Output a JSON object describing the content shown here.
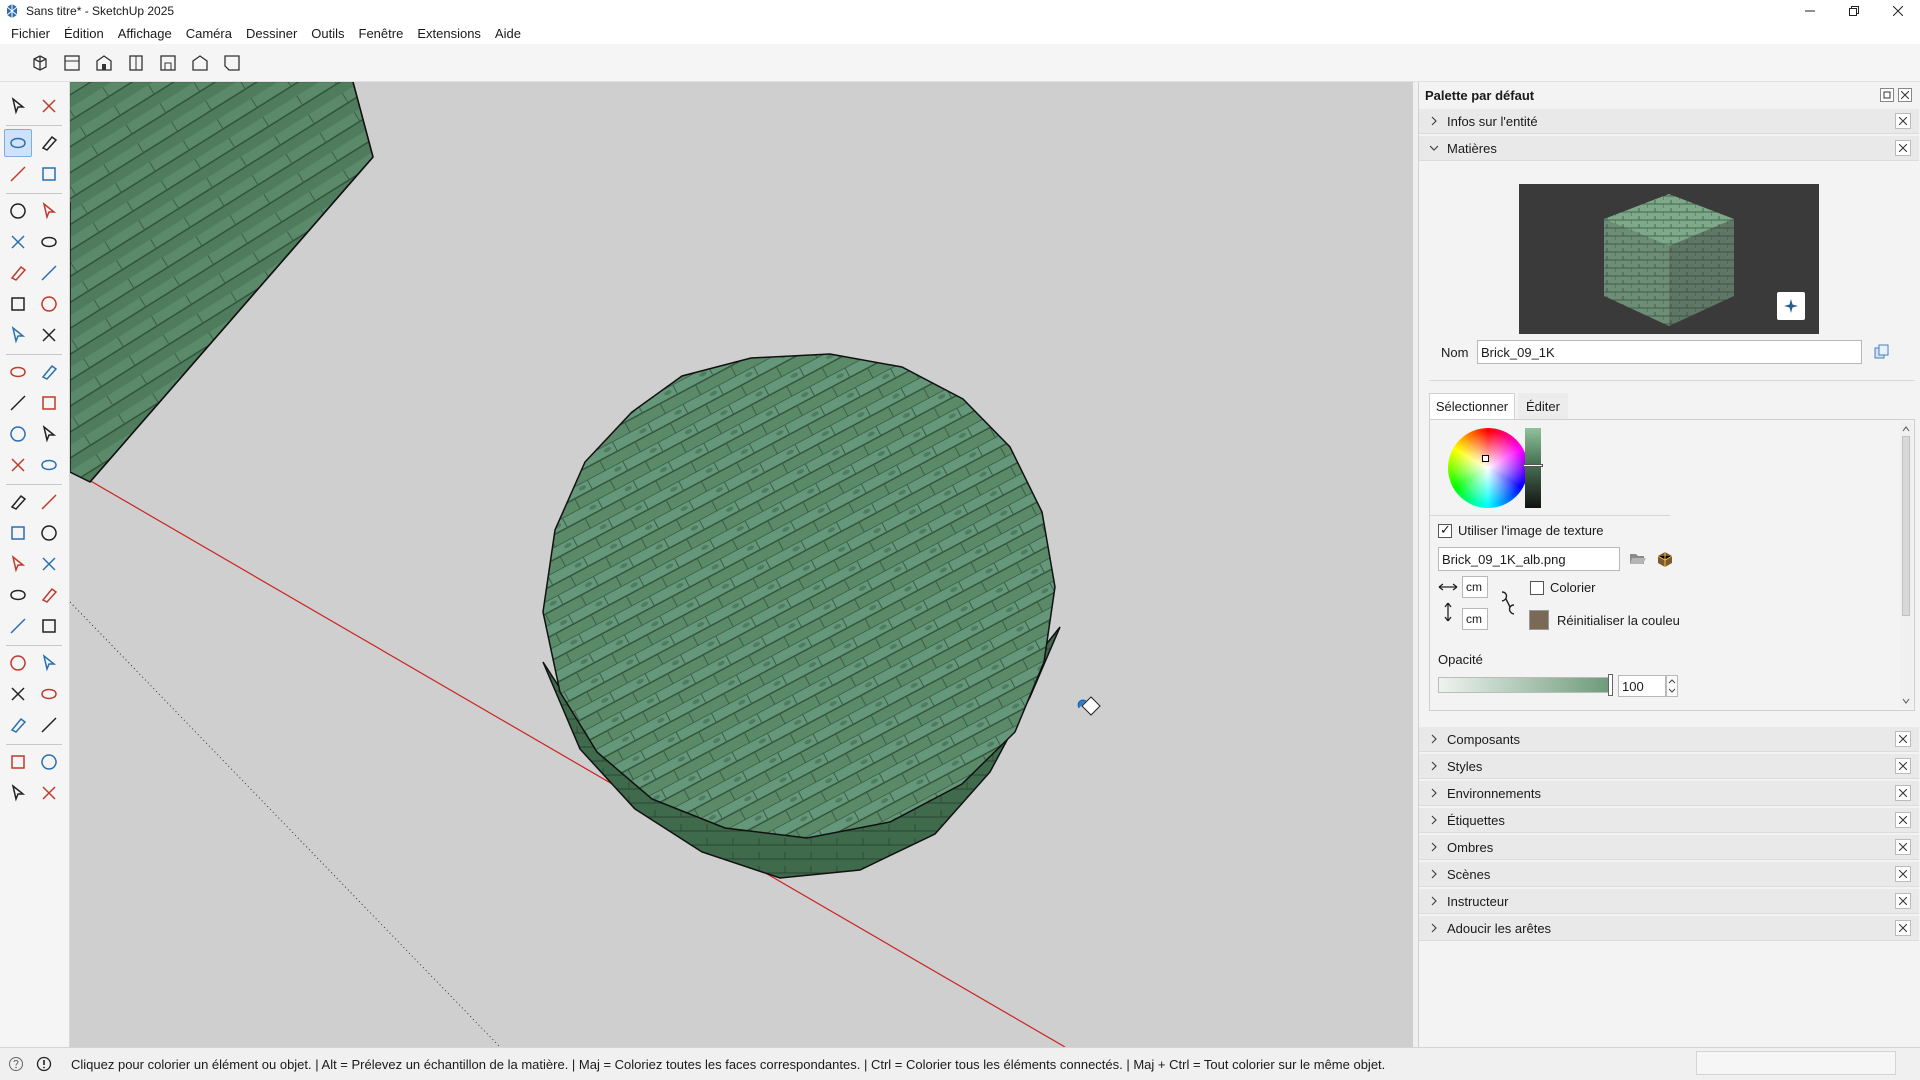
{
  "window": {
    "title": "Sans titre* - SketchUp 2025",
    "controls": [
      "minimize",
      "restore",
      "close"
    ]
  },
  "menu": [
    "Fichier",
    "Édition",
    "Affichage",
    "Caméra",
    "Dessiner",
    "Outils",
    "Fenêtre",
    "Extensions",
    "Aide"
  ],
  "top_toolbar": {
    "icons": [
      "iso-view-icon",
      "top-view-icon",
      "front-view-icon",
      "right-view-icon",
      "back-view-icon",
      "left-view-icon",
      "bottom-view-icon"
    ]
  },
  "left_toolbar": {
    "active_tool": "paint-bucket-icon",
    "tools": [
      "select",
      "lasso",
      "paint-bucket",
      "eraser",
      "tag",
      "tape-eraser",
      "line",
      "freehand",
      "rectangle",
      "rotated-rect",
      "circle",
      "polygon",
      "arc",
      "pie",
      "3pt-arc",
      "2pt-arc",
      "move",
      "push-pull",
      "rotate",
      "follow-me",
      "scale",
      "offset",
      "explode",
      "pyramid",
      "tape-measure",
      "dimension",
      "protractor",
      "text",
      "axes",
      "3d-text",
      "section-plane",
      "pan-hand",
      "zoom",
      "zoom-window",
      "zoom-extents",
      "previous",
      "position-camera",
      "walk",
      "look-around",
      "sound",
      "warehouse",
      "extension-warehouse",
      "layers",
      "components"
    ]
  },
  "panel": {
    "title": "Palette par défaut",
    "trays_top": [
      {
        "label": "Infos sur l'entité",
        "expanded": false
      },
      {
        "label": "Matières",
        "expanded": true
      }
    ],
    "material": {
      "name_label": "Nom",
      "name_value": "Brick_09_1K",
      "tabs": [
        "Sélectionner",
        "Éditer"
      ],
      "active_tab": "Éditer",
      "use_texture_label": "Utiliser l'image de texture",
      "use_texture_checked": true,
      "texture_file": "Brick_09_1K_alb.png",
      "width_unit": "cm",
      "height_unit": "cm",
      "colorize_label": "Colorier",
      "colorize_checked": false,
      "reset_color_label": "Réinitialiser la couleu",
      "opacity_label": "Opacité",
      "opacity_value": "100",
      "opacity_fraction": 1.0,
      "color_swatch": "#7a6a55"
    },
    "trays_bottom": [
      {
        "label": "Composants"
      },
      {
        "label": "Styles"
      },
      {
        "label": "Environnements"
      },
      {
        "label": "Étiquettes"
      },
      {
        "label": "Ombres"
      },
      {
        "label": "Scènes"
      },
      {
        "label": "Instructeur"
      },
      {
        "label": "Adoucir les arêtes"
      }
    ]
  },
  "status": {
    "text": "Cliquez pour colorier un élément ou objet. | Alt = Prélevez un échantillon de la matière. | Maj = Coloriez toutes les faces correspondantes. | Ctrl = Colorier tous les éléments connectés. | Maj + Ctrl = Tout colorier sur le même objet."
  },
  "colors": {
    "viewport_bg": "#cfcfcf",
    "red_axis": "#cc2222",
    "green_texture": "#4e7a5a",
    "accent_blue": "#2a7fd4"
  }
}
